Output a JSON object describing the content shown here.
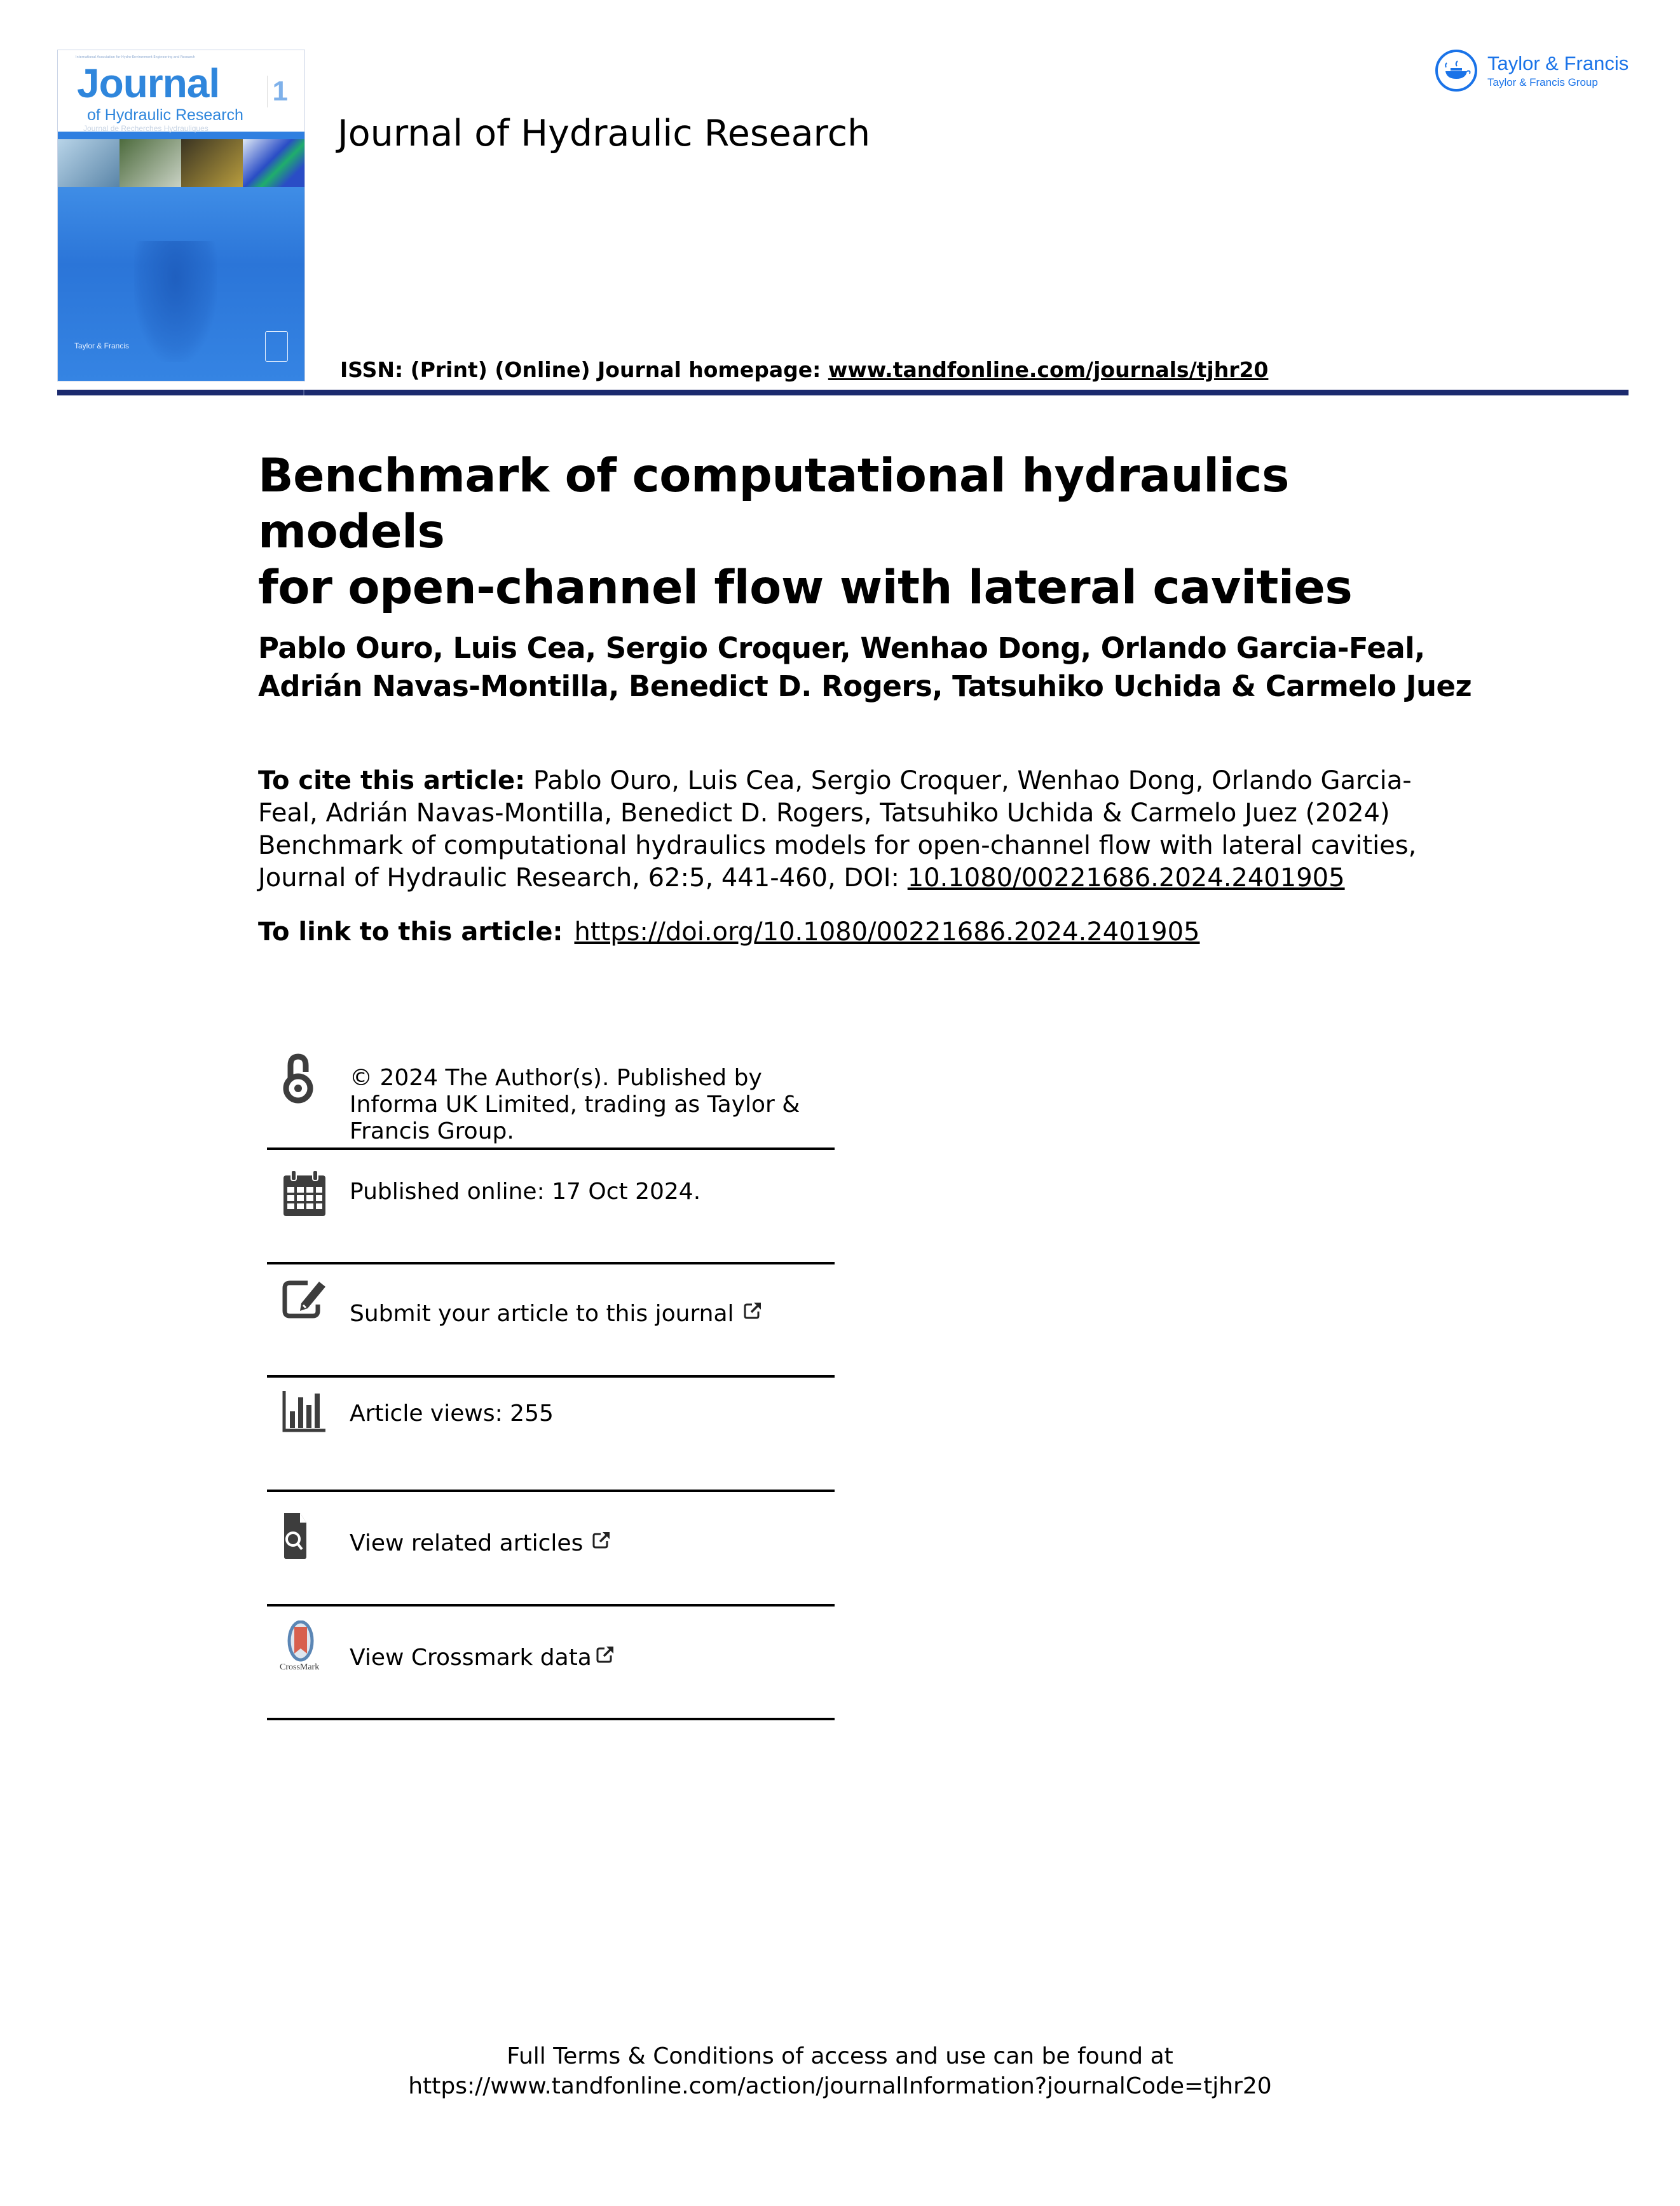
{
  "header": {
    "cover": {
      "top_line": "International Association for Hydro-Environment Engineering and Research",
      "title_main": "Journal",
      "title_sub": "of Hydraulic Research",
      "title_french": "Journal de Recherches Hydrauliques",
      "issue_number": "1",
      "publisher_mark": "Taylor & Francis",
      "photo_colors": [
        "#8bb6d6",
        "#7f9a6a",
        "#9a8a4c",
        "#2c4fc4"
      ]
    },
    "journal_title": "Journal of Hydraulic Research",
    "issn_label": "ISSN: (Print) (Online) Journal homepage: ",
    "homepage_link": "www.tandfonline.com/journals/tjhr20",
    "publisher_logo": {
      "name": "Taylor & Francis",
      "group": "Taylor & Francis Group",
      "color": "#1a73e8"
    },
    "rule_color": "#1b2a6e"
  },
  "article": {
    "title_lines": [
      "Benchmark of computational hydraulics models",
      "for open-channel flow with lateral cavities"
    ],
    "author_lines": [
      "Pablo Ouro, Luis Cea, Sergio Croquer, Wenhao Dong, Orlando Garcia-Feal,",
      "Adrián Navas-Montilla, Benedict D. Rogers, Tatsuhiko Uchida & Carmelo Juez"
    ],
    "cite_label": "To cite this article:",
    "cite_text": " Pablo Ouro, Luis Cea, Sergio Croquer, Wenhao Dong, Orlando Garcia-Feal, Adrián Navas-Montilla, Benedict D. Rogers, Tatsuhiko Uchida & Carmelo Juez (2024) Benchmark of computational hydraulics models for open-channel flow with lateral cavities, Journal of Hydraulic Research, 62:5, 441-460, DOI: ",
    "cite_doi": "10.1080/00221686.2024.2401905",
    "link_label": "To link to this article:",
    "link_url": "https://doi.org/10.1080/00221686.2024.2401905"
  },
  "info_box": [
    {
      "icon": "open-access-icon",
      "text": "© 2024 The Author(s). Published by Informa UK Limited, trading as Taylor & Francis Group.",
      "external": false
    },
    {
      "icon": "calendar-icon",
      "text": "Published online: 17 Oct 2024.",
      "external": false
    },
    {
      "icon": "edit-icon",
      "text": "Submit your article to this journal",
      "external": true
    },
    {
      "icon": "bar-chart-icon",
      "text": "Article views: 255",
      "external": false
    },
    {
      "icon": "related-articles-icon",
      "text": "View related articles",
      "external": true
    },
    {
      "icon": "crossmark-icon",
      "text": "View Crossmark data",
      "external": true,
      "icon_caption": "CrossMark"
    }
  ],
  "footer": {
    "line1": "Full Terms & Conditions of access and use can be found at",
    "line2": "https://www.tandfonline.com/action/journalInformation?journalCode=tjhr20"
  }
}
